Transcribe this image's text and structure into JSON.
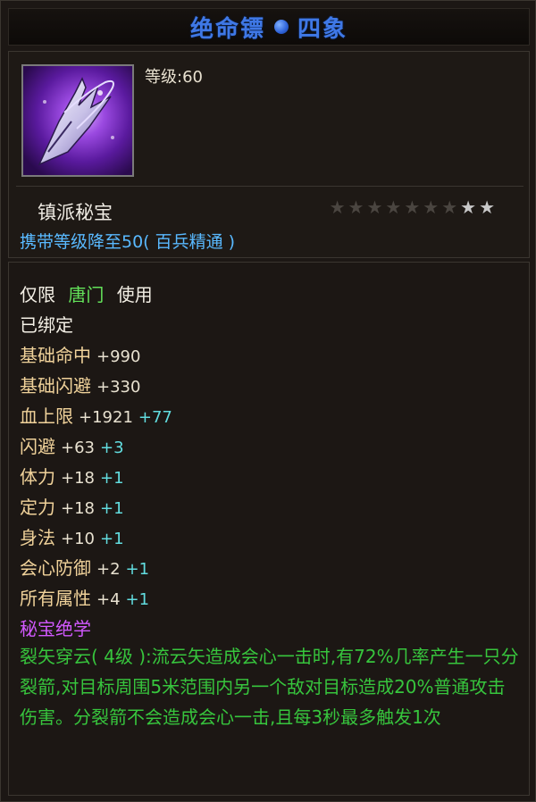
{
  "title": {
    "name": "绝命镖",
    "suffix": "四象"
  },
  "item": {
    "icon": "dart-weapon-icon",
    "level_label": "等级:60",
    "category": "镇派秘宝",
    "stars": [
      "dim",
      "dim",
      "dim",
      "dim",
      "dim",
      "dim",
      "dim",
      "bright",
      "bright"
    ],
    "carry_text": "携带等级降至50( 百兵精通 )"
  },
  "restriction": {
    "prefix": "仅限",
    "sect": "唐门",
    "suffix": "使用"
  },
  "bound": "已绑定",
  "stats": [
    {
      "name": "基础命中",
      "value": "+990",
      "bonus": ""
    },
    {
      "name": "基础闪避",
      "value": "+330",
      "bonus": ""
    },
    {
      "name": "血上限",
      "value": "+1921",
      "bonus": "+77"
    },
    {
      "name": "闪避",
      "value": "+63",
      "bonus": "+3"
    },
    {
      "name": "体力",
      "value": "+18",
      "bonus": "+1"
    },
    {
      "name": "定力",
      "value": "+18",
      "bonus": "+1"
    },
    {
      "name": "身法",
      "value": "+10",
      "bonus": "+1"
    },
    {
      "name": "会心防御",
      "value": "+2",
      "bonus": "+1"
    },
    {
      "name": "所有属性",
      "value": "+4",
      "bonus": "+1"
    }
  ],
  "skill": {
    "header": "秘宝绝学",
    "description": "裂矢穿云( 4级 ):流云矢造成会心一击时,有72%几率产生一只分裂箭,对目标周围5米范围内另一个敌对目标造成20%普通攻击伤害。分裂箭不会造成会心一击,且每3秒最多触发1次"
  },
  "colors": {
    "title": "#3f78e6",
    "carry": "#59b9ff",
    "sect": "#63e25a",
    "stat_name": "#f0d29a",
    "bonus": "#62dde0",
    "skill_header": "#d259ff",
    "skill_text": "#37c53d",
    "star_dim": "#4a4540",
    "star_bright": "#c8c8c8"
  }
}
